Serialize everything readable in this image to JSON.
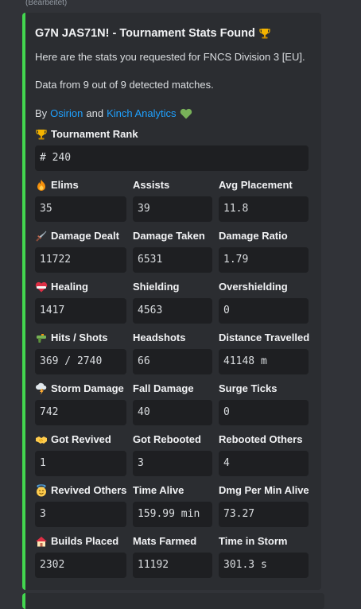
{
  "edited_label": "(Bearbeitet)",
  "embed": {
    "accent_color": "#43d64f",
    "title": "G7N JAS71N! - Tournament Stats Found",
    "title_icon": "trophy-icon",
    "desc_line1": "Here are the stats you requested for FNCS Division 3 [EU].",
    "desc_line2": "Data from 9 out of 9 detected matches.",
    "by_prefix": "By",
    "by_link1": "Osirion",
    "by_and": "and",
    "by_link2": "Kinch Analytics",
    "by_icon": "green-heart-icon",
    "rank": {
      "icon": "trophy-icon",
      "name": "Tournament Rank",
      "value": "# 240"
    },
    "rows": [
      [
        {
          "icon": "fire-icon",
          "name": "Elims",
          "value": "35"
        },
        {
          "name": "Assists",
          "value": "39"
        },
        {
          "name": "Avg Placement",
          "value": "11.8"
        }
      ],
      [
        {
          "icon": "dagger-icon",
          "name": "Damage Dealt",
          "value": "11722"
        },
        {
          "name": "Damage Taken",
          "value": "6531"
        },
        {
          "name": "Damage Ratio",
          "value": "1.79"
        }
      ],
      [
        {
          "icon": "mending-heart-icon",
          "name": "Healing",
          "value": "1417"
        },
        {
          "name": "Shielding",
          "value": "4563"
        },
        {
          "name": "Overshielding",
          "value": "0"
        }
      ],
      [
        {
          "icon": "water-pistol-icon",
          "name": "Hits / Shots",
          "value": "369 / 2740"
        },
        {
          "name": "Headshots",
          "value": "66"
        },
        {
          "name": "Distance Travelled",
          "value": "41148 m"
        }
      ],
      [
        {
          "icon": "storm-cloud-icon",
          "name": "Storm Damage",
          "value": "742"
        },
        {
          "name": "Fall Damage",
          "value": "40"
        },
        {
          "name": "Surge Ticks",
          "value": "0"
        }
      ],
      [
        {
          "icon": "handshake-icon",
          "name": "Got Revived",
          "value": "1"
        },
        {
          "name": "Got Rebooted",
          "value": "3"
        },
        {
          "name": "Rebooted Others",
          "value": "4"
        }
      ],
      [
        {
          "icon": "halo-face-icon",
          "name": "Revived Others",
          "value": "3"
        },
        {
          "name": "Time Alive",
          "value": "159.99 min"
        },
        {
          "name": "Dmg Per Min Alive",
          "value": "73.27"
        }
      ],
      [
        {
          "icon": "house-icon",
          "name": "Builds Placed",
          "value": "2302"
        },
        {
          "name": "Mats Farmed",
          "value": "11192"
        },
        {
          "name": "Time in Storm",
          "value": "301.3 s"
        }
      ]
    ]
  }
}
